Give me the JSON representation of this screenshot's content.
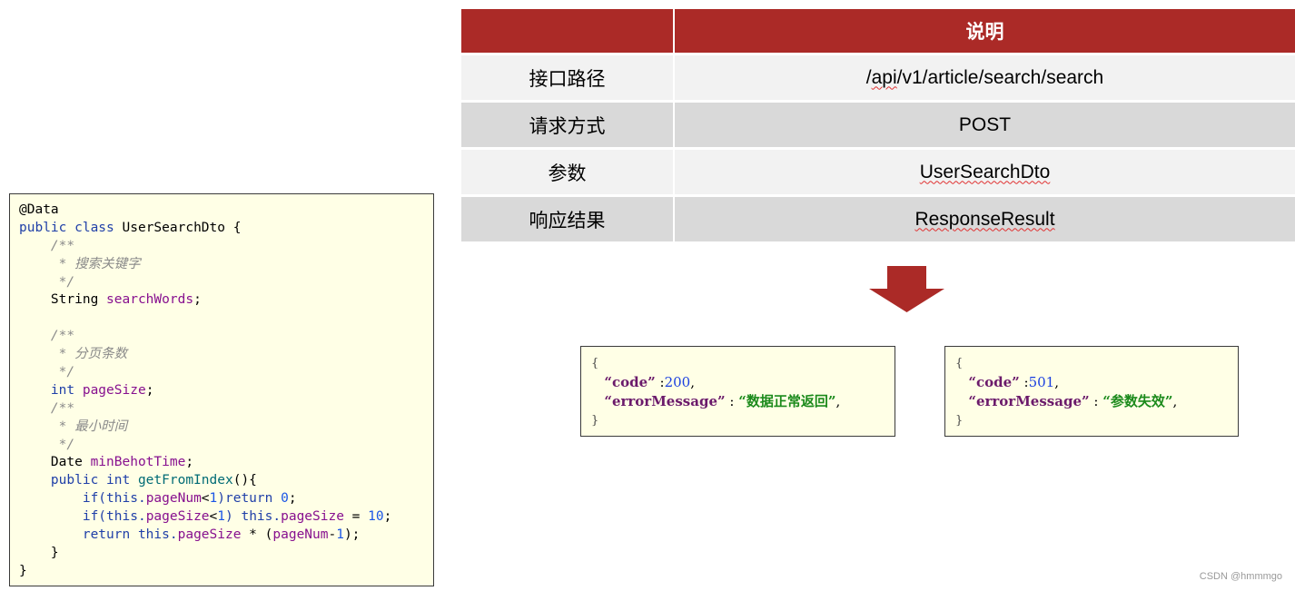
{
  "code": {
    "lines": [
      [
        {
          "t": "@Data",
          "c": "plain"
        }
      ],
      [
        {
          "t": "public class ",
          "c": "kw"
        },
        {
          "t": "UserSearchDto {",
          "c": "plain"
        }
      ],
      [
        {
          "t": "    /**",
          "c": "cmt"
        }
      ],
      [
        {
          "t": "     * 搜索关键字",
          "c": "cmt"
        }
      ],
      [
        {
          "t": "     */",
          "c": "cmt"
        }
      ],
      [
        {
          "t": "    String ",
          "c": "plain"
        },
        {
          "t": "searchWords",
          "c": "fld"
        },
        {
          "t": ";",
          "c": "plain"
        }
      ],
      [
        {
          "t": "",
          "c": "plain"
        }
      ],
      [
        {
          "t": "    /**",
          "c": "cmt"
        }
      ],
      [
        {
          "t": "     * 分页条数",
          "c": "cmt"
        }
      ],
      [
        {
          "t": "     */",
          "c": "cmt"
        }
      ],
      [
        {
          "t": "    int ",
          "c": "kw"
        },
        {
          "t": "pageSize",
          "c": "fld"
        },
        {
          "t": ";",
          "c": "plain"
        }
      ],
      [
        {
          "t": "    /**",
          "c": "cmt"
        }
      ],
      [
        {
          "t": "     * 最小时间",
          "c": "cmt"
        }
      ],
      [
        {
          "t": "     */",
          "c": "cmt"
        }
      ],
      [
        {
          "t": "    Date ",
          "c": "plain"
        },
        {
          "t": "minBehotTime",
          "c": "fld"
        },
        {
          "t": ";",
          "c": "plain"
        }
      ],
      [
        {
          "t": "    public int ",
          "c": "kw"
        },
        {
          "t": "getFromIndex",
          "c": "mth"
        },
        {
          "t": "(){",
          "c": "plain"
        }
      ],
      [
        {
          "t": "        if(this.",
          "c": "kw"
        },
        {
          "t": "pageNum",
          "c": "fld"
        },
        {
          "t": "<",
          "c": "plain"
        },
        {
          "t": "1",
          "c": "num"
        },
        {
          "t": ")return ",
          "c": "kw"
        },
        {
          "t": "0",
          "c": "num"
        },
        {
          "t": ";",
          "c": "plain"
        }
      ],
      [
        {
          "t": "        if(this.",
          "c": "kw"
        },
        {
          "t": "pageSize",
          "c": "fld"
        },
        {
          "t": "<",
          "c": "plain"
        },
        {
          "t": "1",
          "c": "num"
        },
        {
          "t": ") this.",
          "c": "kw"
        },
        {
          "t": "pageSize",
          "c": "fld"
        },
        {
          "t": " = ",
          "c": "plain"
        },
        {
          "t": "10",
          "c": "num"
        },
        {
          "t": ";",
          "c": "plain"
        }
      ],
      [
        {
          "t": "        return this.",
          "c": "kw"
        },
        {
          "t": "pageSize",
          "c": "fld"
        },
        {
          "t": " * (",
          "c": "plain"
        },
        {
          "t": "pageNum",
          "c": "fld"
        },
        {
          "t": "-",
          "c": "plain"
        },
        {
          "t": "1",
          "c": "num"
        },
        {
          "t": ");",
          "c": "plain"
        }
      ],
      [
        {
          "t": "    }",
          "c": "plain"
        }
      ],
      [
        {
          "t": "}",
          "c": "plain"
        }
      ]
    ]
  },
  "table": {
    "header": {
      "col1": "",
      "col2": "说明"
    },
    "rows": [
      {
        "label": "接口路径",
        "value": "/api/v1/article/search/search"
      },
      {
        "label": "请求方式",
        "value": "POST"
      },
      {
        "label": "参数",
        "value": "UserSearchDto"
      },
      {
        "label": "响应结果",
        "value": "ResponseResult"
      }
    ]
  },
  "arrow": {
    "icon": "down-arrow-icon",
    "color": "#ab2a27"
  },
  "responses": [
    {
      "open": "{",
      "code_key": "“code”",
      "code_value": "200",
      "msg_key": "“errorMessage”",
      "msg_value": "“数据正常返回”",
      "close": "}"
    },
    {
      "open": "{",
      "code_key": "“code”",
      "code_value": "501",
      "msg_key": "“errorMessage”",
      "msg_value": "“参数失效”",
      "close": "}"
    }
  ],
  "watermark": "CSDN @hmmmgo",
  "colors": {
    "header_red": "#ab2a27",
    "row_light": "#f2f2f2",
    "row_dark": "#d9d9d9",
    "box_bg": "#ffffe6"
  }
}
